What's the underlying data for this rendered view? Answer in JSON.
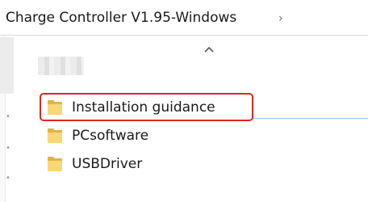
{
  "breadcrumb": {
    "path": "Charge Controller V1.95-Windows",
    "chevron_icon": "chevron-right-icon"
  },
  "nav": {
    "collapse_icon": "chevron-up-icon",
    "pin_icon": "pin-icon"
  },
  "files": [
    {
      "name": "Installation guidance",
      "icon": "folder-icon",
      "highlighted": true
    },
    {
      "name": "PCsoftware",
      "icon": "folder-icon",
      "highlighted": false
    },
    {
      "name": "USBDriver",
      "icon": "folder-icon",
      "highlighted": false
    }
  ],
  "colors": {
    "folder": "#f8d775",
    "highlight_border": "#e0261e",
    "selection_line": "#9fc3ea"
  }
}
